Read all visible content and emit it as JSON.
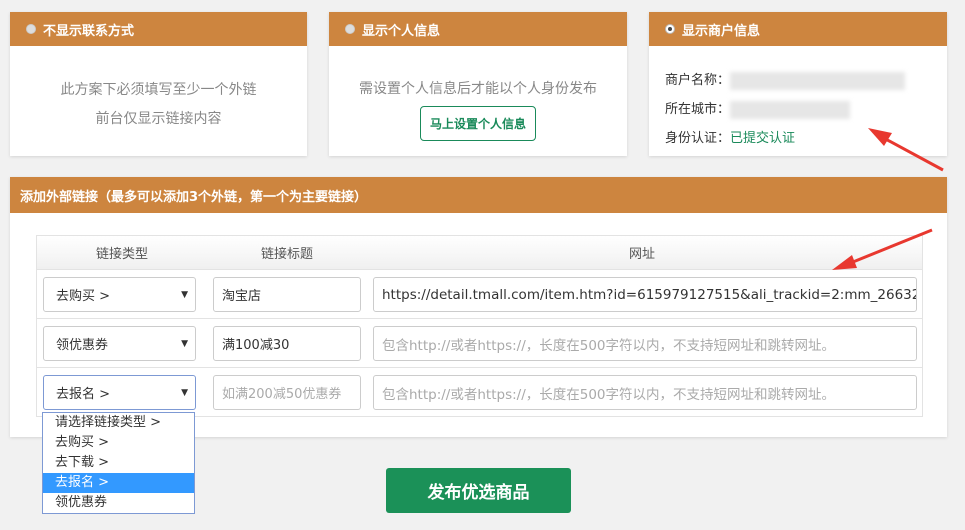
{
  "cards": [
    {
      "title": "不显示联系方式",
      "selected": false,
      "lines": [
        "此方案下必须填写至少一个外链",
        "前台仅显示链接内容"
      ]
    },
    {
      "title": "显示个人信息",
      "selected": false,
      "text": "需设置个人信息后才能以个人身份发布",
      "button": "马上设置个人信息"
    },
    {
      "title": "显示商户信息",
      "selected": true,
      "name_label": "商户名称：",
      "city_label": "所在城市：",
      "auth_label": "身份认证：",
      "auth_value": "已提交认证"
    }
  ],
  "links": {
    "title": "添加外部链接（最多可以添加3个外链，第一个为主要链接）",
    "headers": [
      "链接类型",
      "链接标题",
      "网址"
    ],
    "rows": [
      {
        "type": "去购买 >",
        "title": "淘宝店",
        "url": "https://detail.tmall.com/item.htm?id=615979127515&ali_trackid=2:mm_26632"
      },
      {
        "type": "领优惠券",
        "title": "满100减30",
        "url_placeholder": "包含http://或者https://，长度在500字符以内，不支持短网址和跳转网址。"
      },
      {
        "type": "去报名 >",
        "title_placeholder": "如满200减50优惠券",
        "url_placeholder": "包含http://或者https://，长度在500字符以内，不支持短网址和跳转网址。"
      }
    ],
    "dropdown_options": [
      "请选择链接类型 >",
      "去购买 >",
      "去下载 >",
      "去报名 >",
      "领优惠券"
    ],
    "dropdown_selected": "去报名 >"
  },
  "publish_label": "发布优选商品",
  "colors": {
    "header": "#cd853f",
    "accent": "#1b9158",
    "annotation": "#e8382f"
  }
}
